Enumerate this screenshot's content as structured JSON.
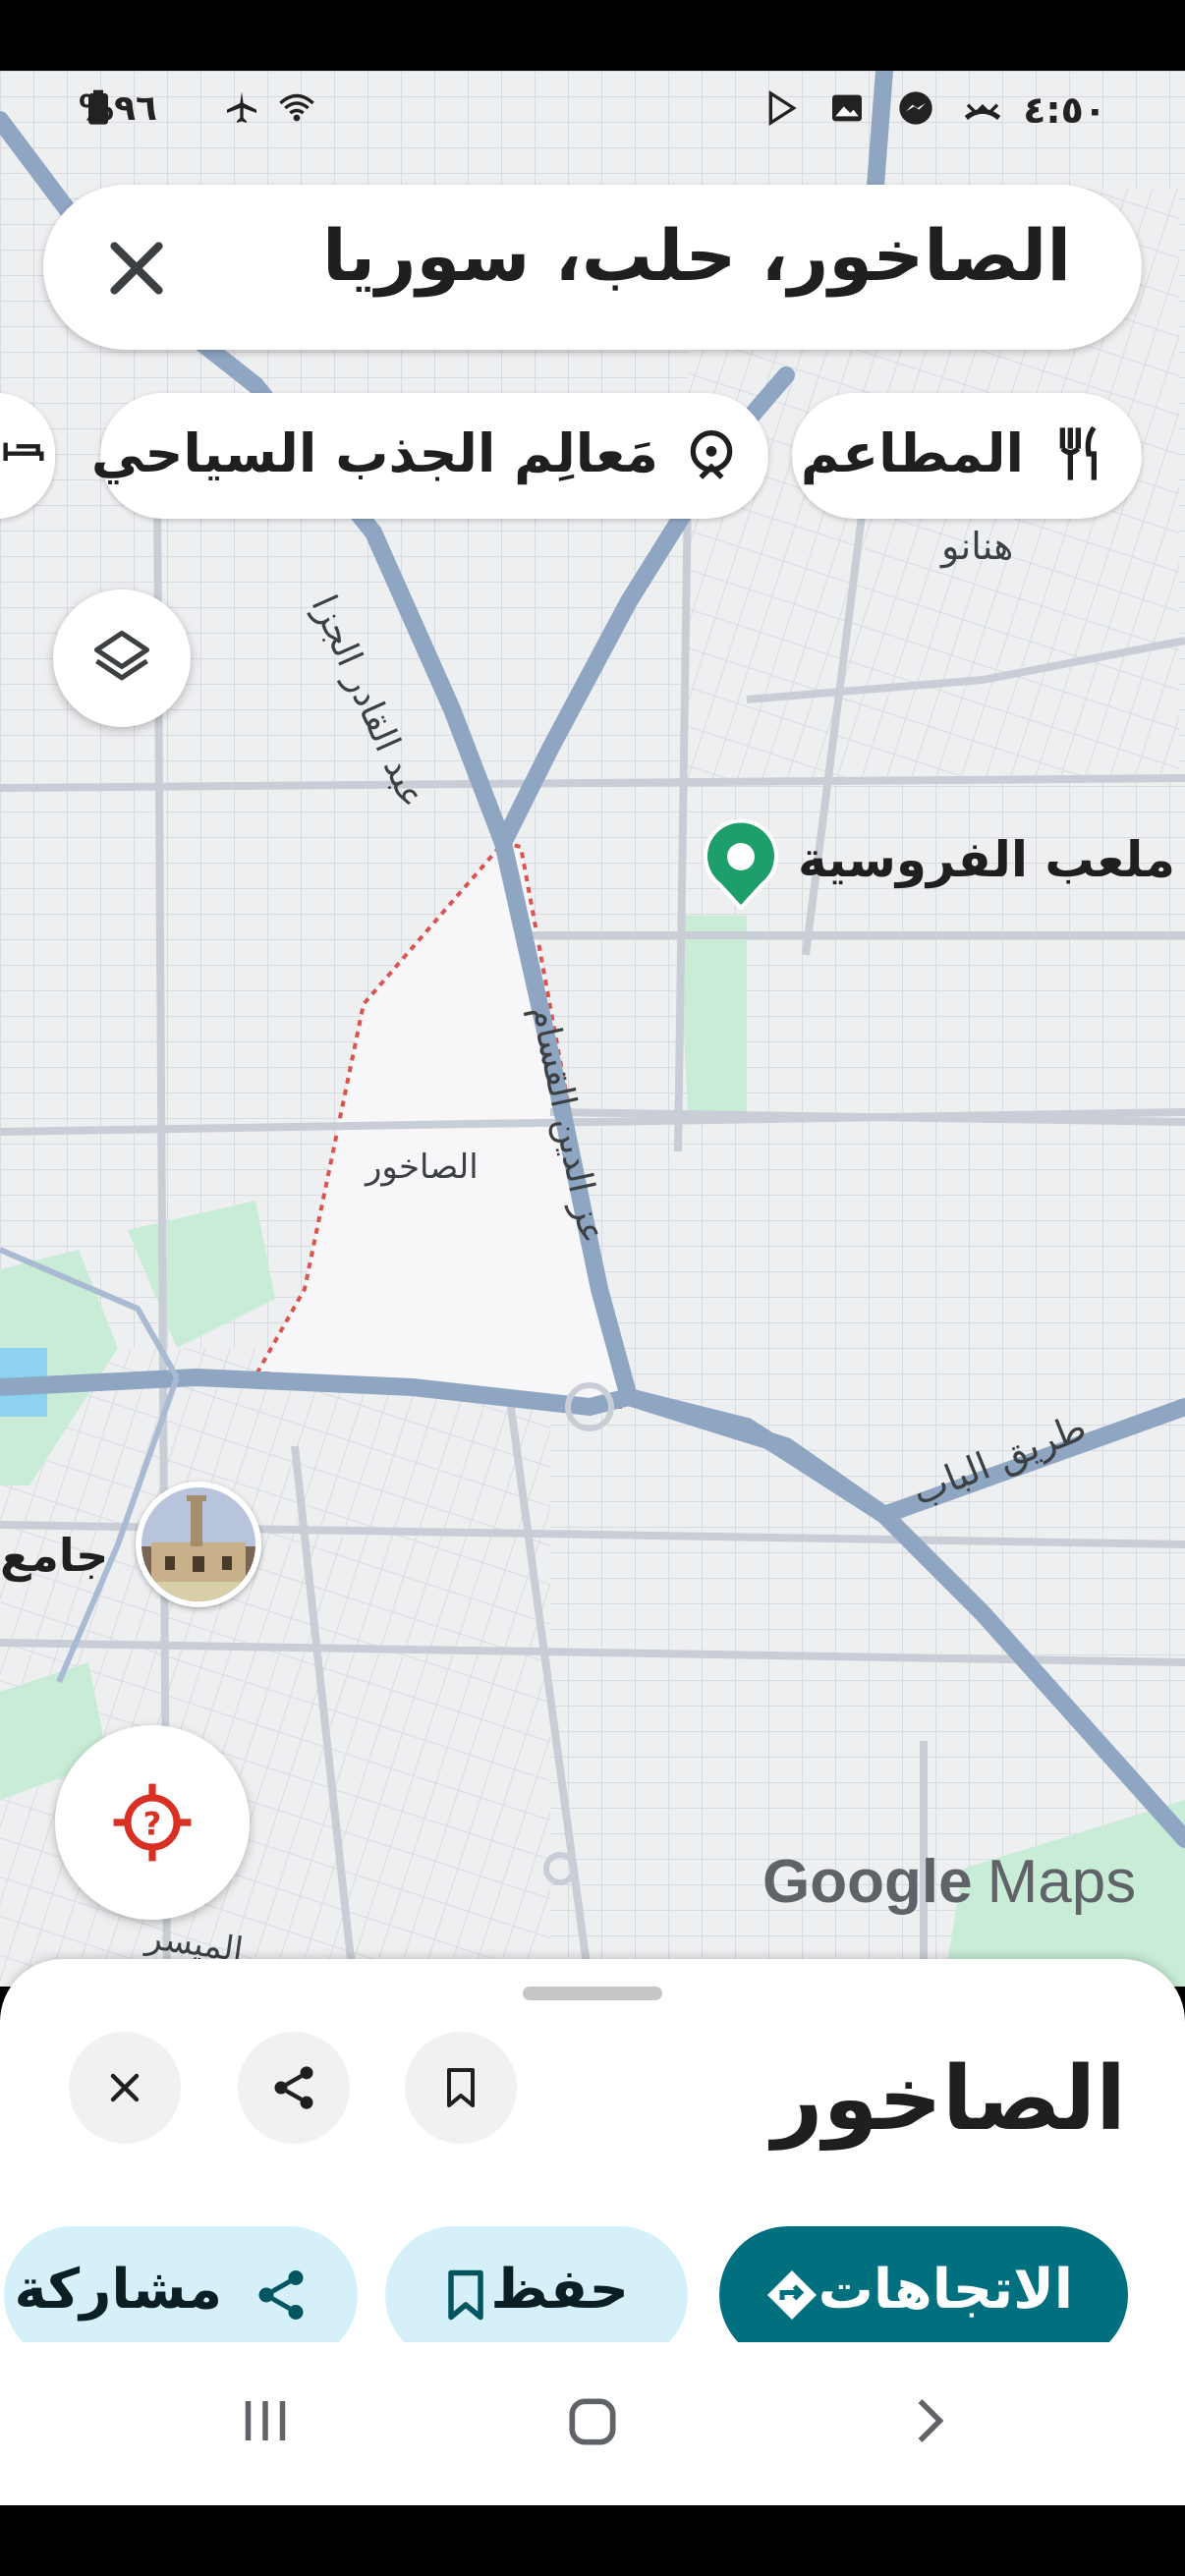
{
  "status_bar": {
    "time": "٤:٥٠",
    "battery": "%٩٦",
    "icons": [
      "missed-call-icon",
      "messenger-icon",
      "gallery-icon",
      "play-store-icon",
      "wifi-icon",
      "airplane-icon",
      "battery-icon"
    ]
  },
  "search": {
    "query": "الصاخور، حلب، سوريا",
    "close_icon": "close-icon"
  },
  "chips": [
    {
      "label": "المطاعم",
      "icon": "restaurant-icon"
    },
    {
      "label": "مَعالِم الجذب السياحي",
      "icon": "attractions-icon"
    }
  ],
  "map": {
    "place_labels": {
      "hanano": "هنانو",
      "stadium": "ملعب الفروسية",
      "area": "الصاخور",
      "mosque_partial": "جامع",
      "road_1": "عبد القادر الجزا",
      "road_2": "عز الدين القسام",
      "road_3": "طريق الباب",
      "road_4": "الميسر"
    },
    "branding": {
      "google": "Google",
      "maps": "Maps"
    },
    "colors": {
      "road": "#8fa6c3",
      "area_border": "#d9534f",
      "park": "#c8ecd6",
      "water": "#8dd3ef",
      "pin": "#1e9e6a"
    }
  },
  "sheet": {
    "title": "الصاخور",
    "actions": [
      {
        "label": "الاتجاهات",
        "icon": "directions-icon",
        "color": "#00707f"
      },
      {
        "label": "حفظ",
        "icon": "bookmark-icon"
      },
      {
        "label": "مشاركة",
        "icon": "share-icon"
      }
    ]
  },
  "nav": {
    "icons": [
      "recent-apps-icon",
      "home-icon",
      "back-icon"
    ]
  }
}
